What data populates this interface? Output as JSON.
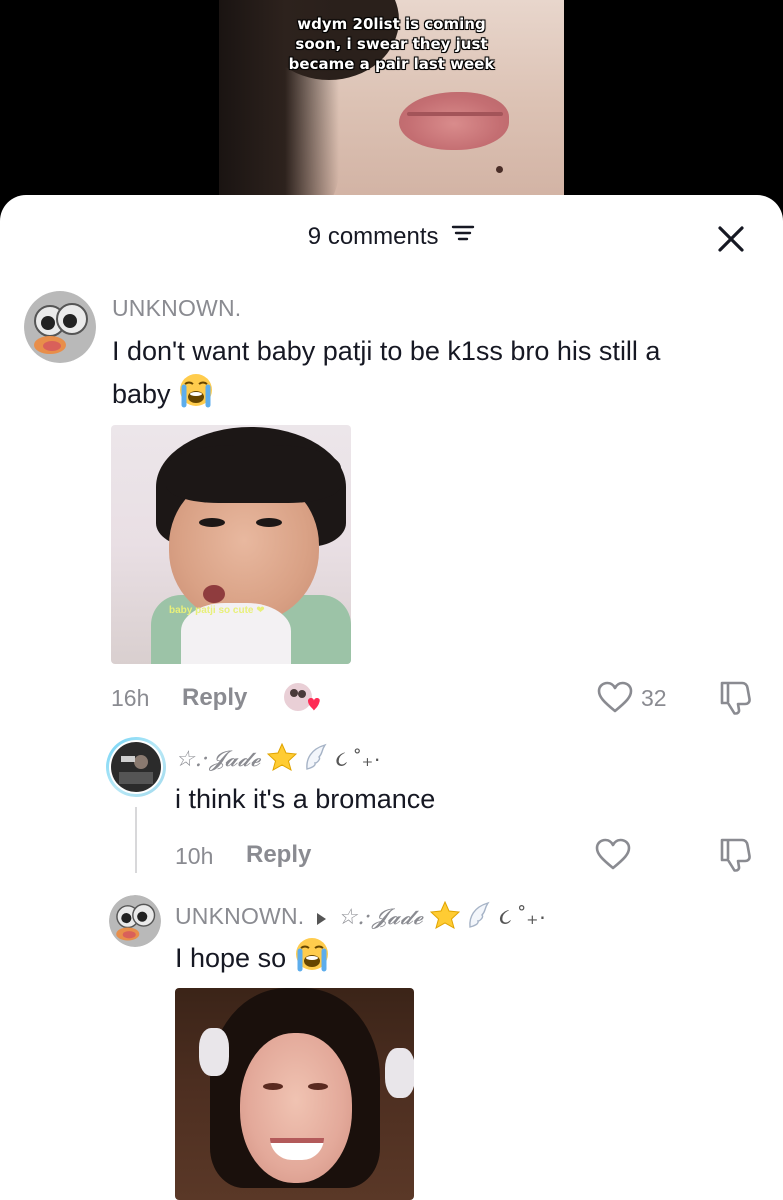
{
  "video": {
    "caption": "wdym 20list is coming\nsoon, i swear they just\nbecame a pair last week"
  },
  "header": {
    "comment_count": "9 comments",
    "sort_icon": "sort-lines-icon",
    "close_icon": "close-x-icon"
  },
  "comments": [
    {
      "username": "UNKNOWN.",
      "text": "I don't want baby patji to be k1ss bro his still a",
      "text_line2": "baby",
      "emoji": "loudly-crying-face",
      "photo_caption": "baby patji so cute ❤",
      "time": "16h",
      "reply_label": "Reply",
      "like_count": "32"
    }
  ],
  "replies": [
    {
      "username": "☆.·𝓙𝓪𝓭𝓮",
      "username_suffix": "૮ ˚₊·",
      "text": "i think it's a bromance",
      "time": "10h",
      "reply_label": "Reply"
    },
    {
      "username": "UNKNOWN.",
      "reply_to": "☆.·𝓙𝓪𝓭𝓮",
      "reply_to_suffix": "૮ ˚₊·",
      "text": "I hope so",
      "emoji": "loudly-crying-face"
    }
  ],
  "colors": {
    "text_primary": "#161823",
    "text_secondary": "#8a8b91",
    "liked_heart": "#fe2c55"
  }
}
